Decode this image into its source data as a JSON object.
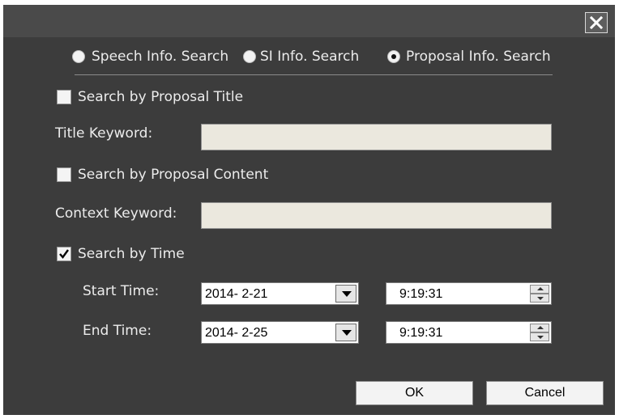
{
  "search_modes": [
    {
      "label": "Speech Info. Search",
      "checked": false
    },
    {
      "label": "SI Info. Search",
      "checked": false
    },
    {
      "label": "Proposal Info. Search",
      "checked": true
    }
  ],
  "by_title": {
    "label": "Search by Proposal Title",
    "checked": false,
    "field_label": "Title Keyword:",
    "value": ""
  },
  "by_content": {
    "label": "Search by Proposal Content",
    "checked": false,
    "field_label": "Context Keyword:",
    "value": ""
  },
  "by_time": {
    "label": "Search by Time",
    "checked": true,
    "start": {
      "label": "Start Time:",
      "date": "2014- 2-21",
      "time": "9:19:31"
    },
    "end": {
      "label": "End Time:",
      "date": "2014- 2-25",
      "time": "9:19:31"
    }
  },
  "buttons": {
    "ok": "OK",
    "cancel": "Cancel"
  },
  "icons": {
    "close": "close-icon",
    "check": "checkmark-icon",
    "dropdown": "dropdown-arrow-icon"
  }
}
